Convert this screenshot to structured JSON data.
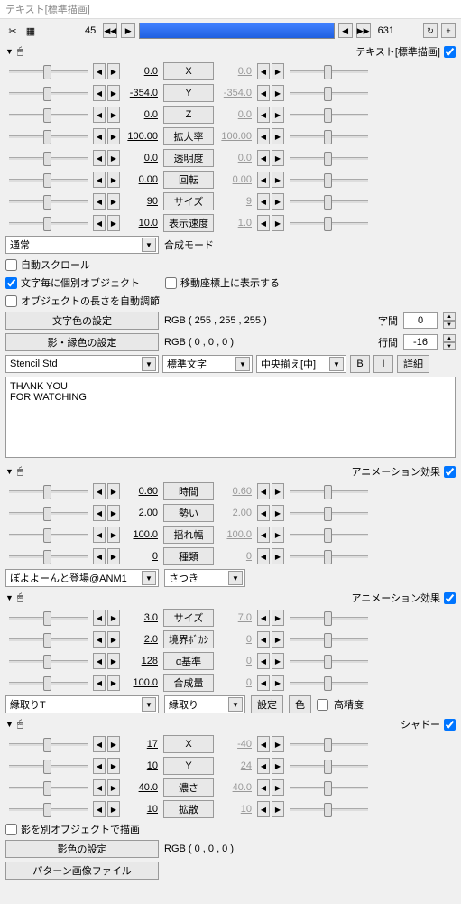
{
  "title": "テキスト[標準描画]",
  "timeline": {
    "start": "45",
    "end": "631"
  },
  "sections": {
    "text": {
      "label": "テキスト[標準描画]",
      "params": [
        {
          "name": "X",
          "l": "0.0",
          "r": "0.0"
        },
        {
          "name": "Y",
          "l": "-354.0",
          "r": "-354.0"
        },
        {
          "name": "Z",
          "l": "0.0",
          "r": "0.0"
        },
        {
          "name": "拡大率",
          "l": "100.00",
          "r": "100.00"
        },
        {
          "name": "透明度",
          "l": "0.0",
          "r": "0.0"
        },
        {
          "name": "回転",
          "l": "0.00",
          "r": "0.00"
        },
        {
          "name": "サイズ",
          "l": "90",
          "r": "9"
        },
        {
          "name": "表示速度",
          "l": "10.0",
          "r": "1.0"
        }
      ],
      "blend": {
        "combo": "通常",
        "label": "合成モード"
      },
      "checks": {
        "autoscroll": "自動スクロール",
        "perchar": "文字毎に個別オブジェクト",
        "showcoord": "移動座標上に表示する",
        "autolen": "オブジェクトの長さを自動調節"
      },
      "color_btn": "文字色の設定",
      "color_rgb": "RGB ( 255 , 255 , 255 )",
      "shadow_btn": "影・縁色の設定",
      "shadow_rgb": "RGB ( 0 , 0 , 0 )",
      "spacing_label": "字間",
      "spacing_val": "0",
      "line_label": "行間",
      "line_val": "-16",
      "font": "Stencil Std",
      "weight": "標準文字",
      "align": "中央揃え[中]",
      "b": "B",
      "i": "I",
      "detail": "詳細",
      "content": "THANK YOU\nFOR WATCHING"
    },
    "anim1": {
      "label": "アニメーション効果",
      "params": [
        {
          "name": "時間",
          "l": "0.60",
          "r": "0.60"
        },
        {
          "name": "勢い",
          "l": "2.00",
          "r": "2.00"
        },
        {
          "name": "揺れ幅",
          "l": "100.0",
          "r": "100.0"
        },
        {
          "name": "種類",
          "l": "0",
          "r": "0"
        }
      ],
      "combo1": "ぽよよーんと登場@ANM1",
      "combo2": "さつき"
    },
    "anim2": {
      "label": "アニメーション効果",
      "params": [
        {
          "name": "サイズ",
          "l": "3.0",
          "r": "7.0"
        },
        {
          "name": "境界ﾎﾞｶｼ",
          "l": "2.0",
          "r": "0"
        },
        {
          "name": "α基準",
          "l": "128",
          "r": "0"
        },
        {
          "name": "合成量",
          "l": "100.0",
          "r": "0"
        }
      ],
      "combo1": "縁取りT",
      "combo2": "縁取り",
      "set_btn": "設定",
      "color_btn": "色",
      "precision": "高精度"
    },
    "shadow": {
      "label": "シャドー",
      "params": [
        {
          "name": "X",
          "l": "17",
          "r": "-40"
        },
        {
          "name": "Y",
          "l": "10",
          "r": "24"
        },
        {
          "name": "濃さ",
          "l": "40.0",
          "r": "40.0"
        },
        {
          "name": "拡散",
          "l": "10",
          "r": "10"
        }
      ],
      "separate": "影を別オブジェクトで描画",
      "color_btn": "影色の設定",
      "color_rgb": "RGB ( 0 , 0 , 0 )",
      "pattern_btn": "パターン画像ファイル"
    }
  }
}
